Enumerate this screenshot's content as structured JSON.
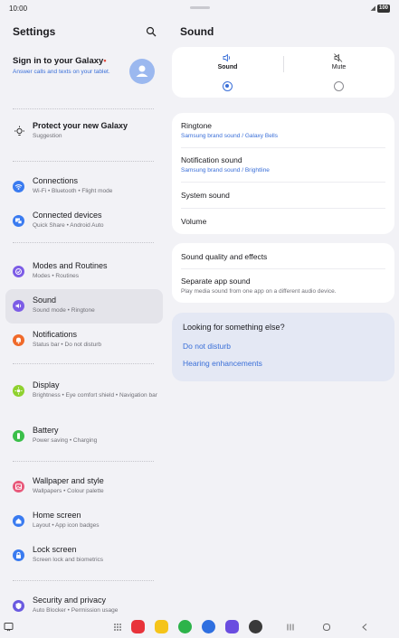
{
  "status": {
    "time": "10:00",
    "battery": "100"
  },
  "left": {
    "title": "Settings",
    "account": {
      "title": "Sign in to your Galaxy",
      "badge": "•",
      "subtitle": "Answer calls and texts on your tablet."
    },
    "suggestion": {
      "title": "Protect your new Galaxy",
      "subtitle": "Suggestion"
    },
    "items": [
      {
        "label": "Connections",
        "sub": "Wi-Fi  •  Bluetooth  •  Flight mode",
        "color": "#3a7bf0"
      },
      {
        "label": "Connected devices",
        "sub": "Quick Share  •  Android Auto",
        "color": "#3a7bf0"
      },
      {
        "label": "Modes and Routines",
        "sub": "Modes  •  Routines",
        "color": "#7c5ce6"
      },
      {
        "label": "Sound",
        "sub": "Sound mode  •  Ringtone",
        "color": "#7c5ce6"
      },
      {
        "label": "Notifications",
        "sub": "Status bar  •  Do not disturb",
        "color": "#f06a2a"
      },
      {
        "label": "Display",
        "sub": "Brightness  •  Eye comfort shield  •  Navigation bar",
        "color": "#8fd12f"
      },
      {
        "label": "Battery",
        "sub": "Power saving  •  Charging",
        "color": "#3bbf4a"
      },
      {
        "label": "Wallpaper and style",
        "sub": "Wallpapers  •  Colour palette",
        "color": "#e8587a"
      },
      {
        "label": "Home screen",
        "sub": "Layout  •  App icon badges",
        "color": "#3a7bf0"
      },
      {
        "label": "Lock screen",
        "sub": "Screen lock and biometrics",
        "color": "#3a7bf0"
      },
      {
        "label": "Security and privacy",
        "sub": "Auto Blocker  •  Permission usage",
        "color": "#6a5ae0"
      }
    ]
  },
  "right": {
    "title": "Sound",
    "modes": [
      {
        "label": "Sound",
        "selected": true,
        "icon": "speaker-icon"
      },
      {
        "label": "Mute",
        "selected": false,
        "icon": "mute-icon"
      }
    ],
    "rows1": [
      {
        "title": "Ringtone",
        "sub": "Samsung brand sound / Galaxy Bells"
      },
      {
        "title": "Notification sound",
        "sub": "Samsung brand sound / Brightline"
      },
      {
        "title": "System sound"
      },
      {
        "title": "Volume"
      }
    ],
    "rows2": [
      {
        "title": "Sound quality and effects"
      },
      {
        "title": "Separate app sound",
        "sub": "Play media sound from one app on a different audio device."
      }
    ],
    "looking": {
      "title": "Looking for something else?",
      "links": [
        "Do not disturb",
        "Hearing enhancements"
      ]
    }
  },
  "colors": {
    "accent": "#3a6fd8",
    "background": "#f2f2f6",
    "card": "#ffffff"
  }
}
